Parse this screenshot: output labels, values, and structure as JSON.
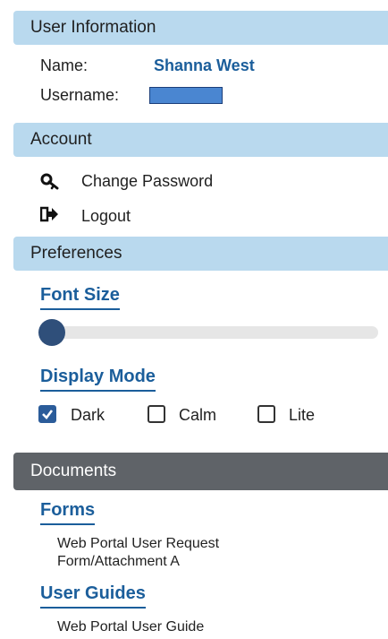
{
  "user_info": {
    "header": "User Information",
    "name_label": "Name:",
    "name_value": "Shanna West",
    "username_label": "Username:"
  },
  "account": {
    "header": "Account",
    "items": [
      {
        "label": "Change Password",
        "icon": "key-icon"
      },
      {
        "label": "Logout",
        "icon": "logout-icon"
      }
    ]
  },
  "preferences": {
    "header": "Preferences",
    "font_size_title": "Font Size",
    "font_size_level": 0,
    "display_mode_title": "Display Mode",
    "modes": [
      {
        "label": "Dark",
        "checked": true
      },
      {
        "label": "Calm",
        "checked": false
      },
      {
        "label": "Lite",
        "checked": false
      }
    ]
  },
  "documents": {
    "header": "Documents",
    "forms_title": "Forms",
    "forms_line1": "Web Portal User Request",
    "forms_line2": "Form/Attachment A",
    "guides_title": "User Guides",
    "guide_item": "Web Portal User Guide"
  },
  "colors": {
    "light_header": "#b9d9ee",
    "dark_header": "#5f6368",
    "accent": "#1b5e9b"
  }
}
